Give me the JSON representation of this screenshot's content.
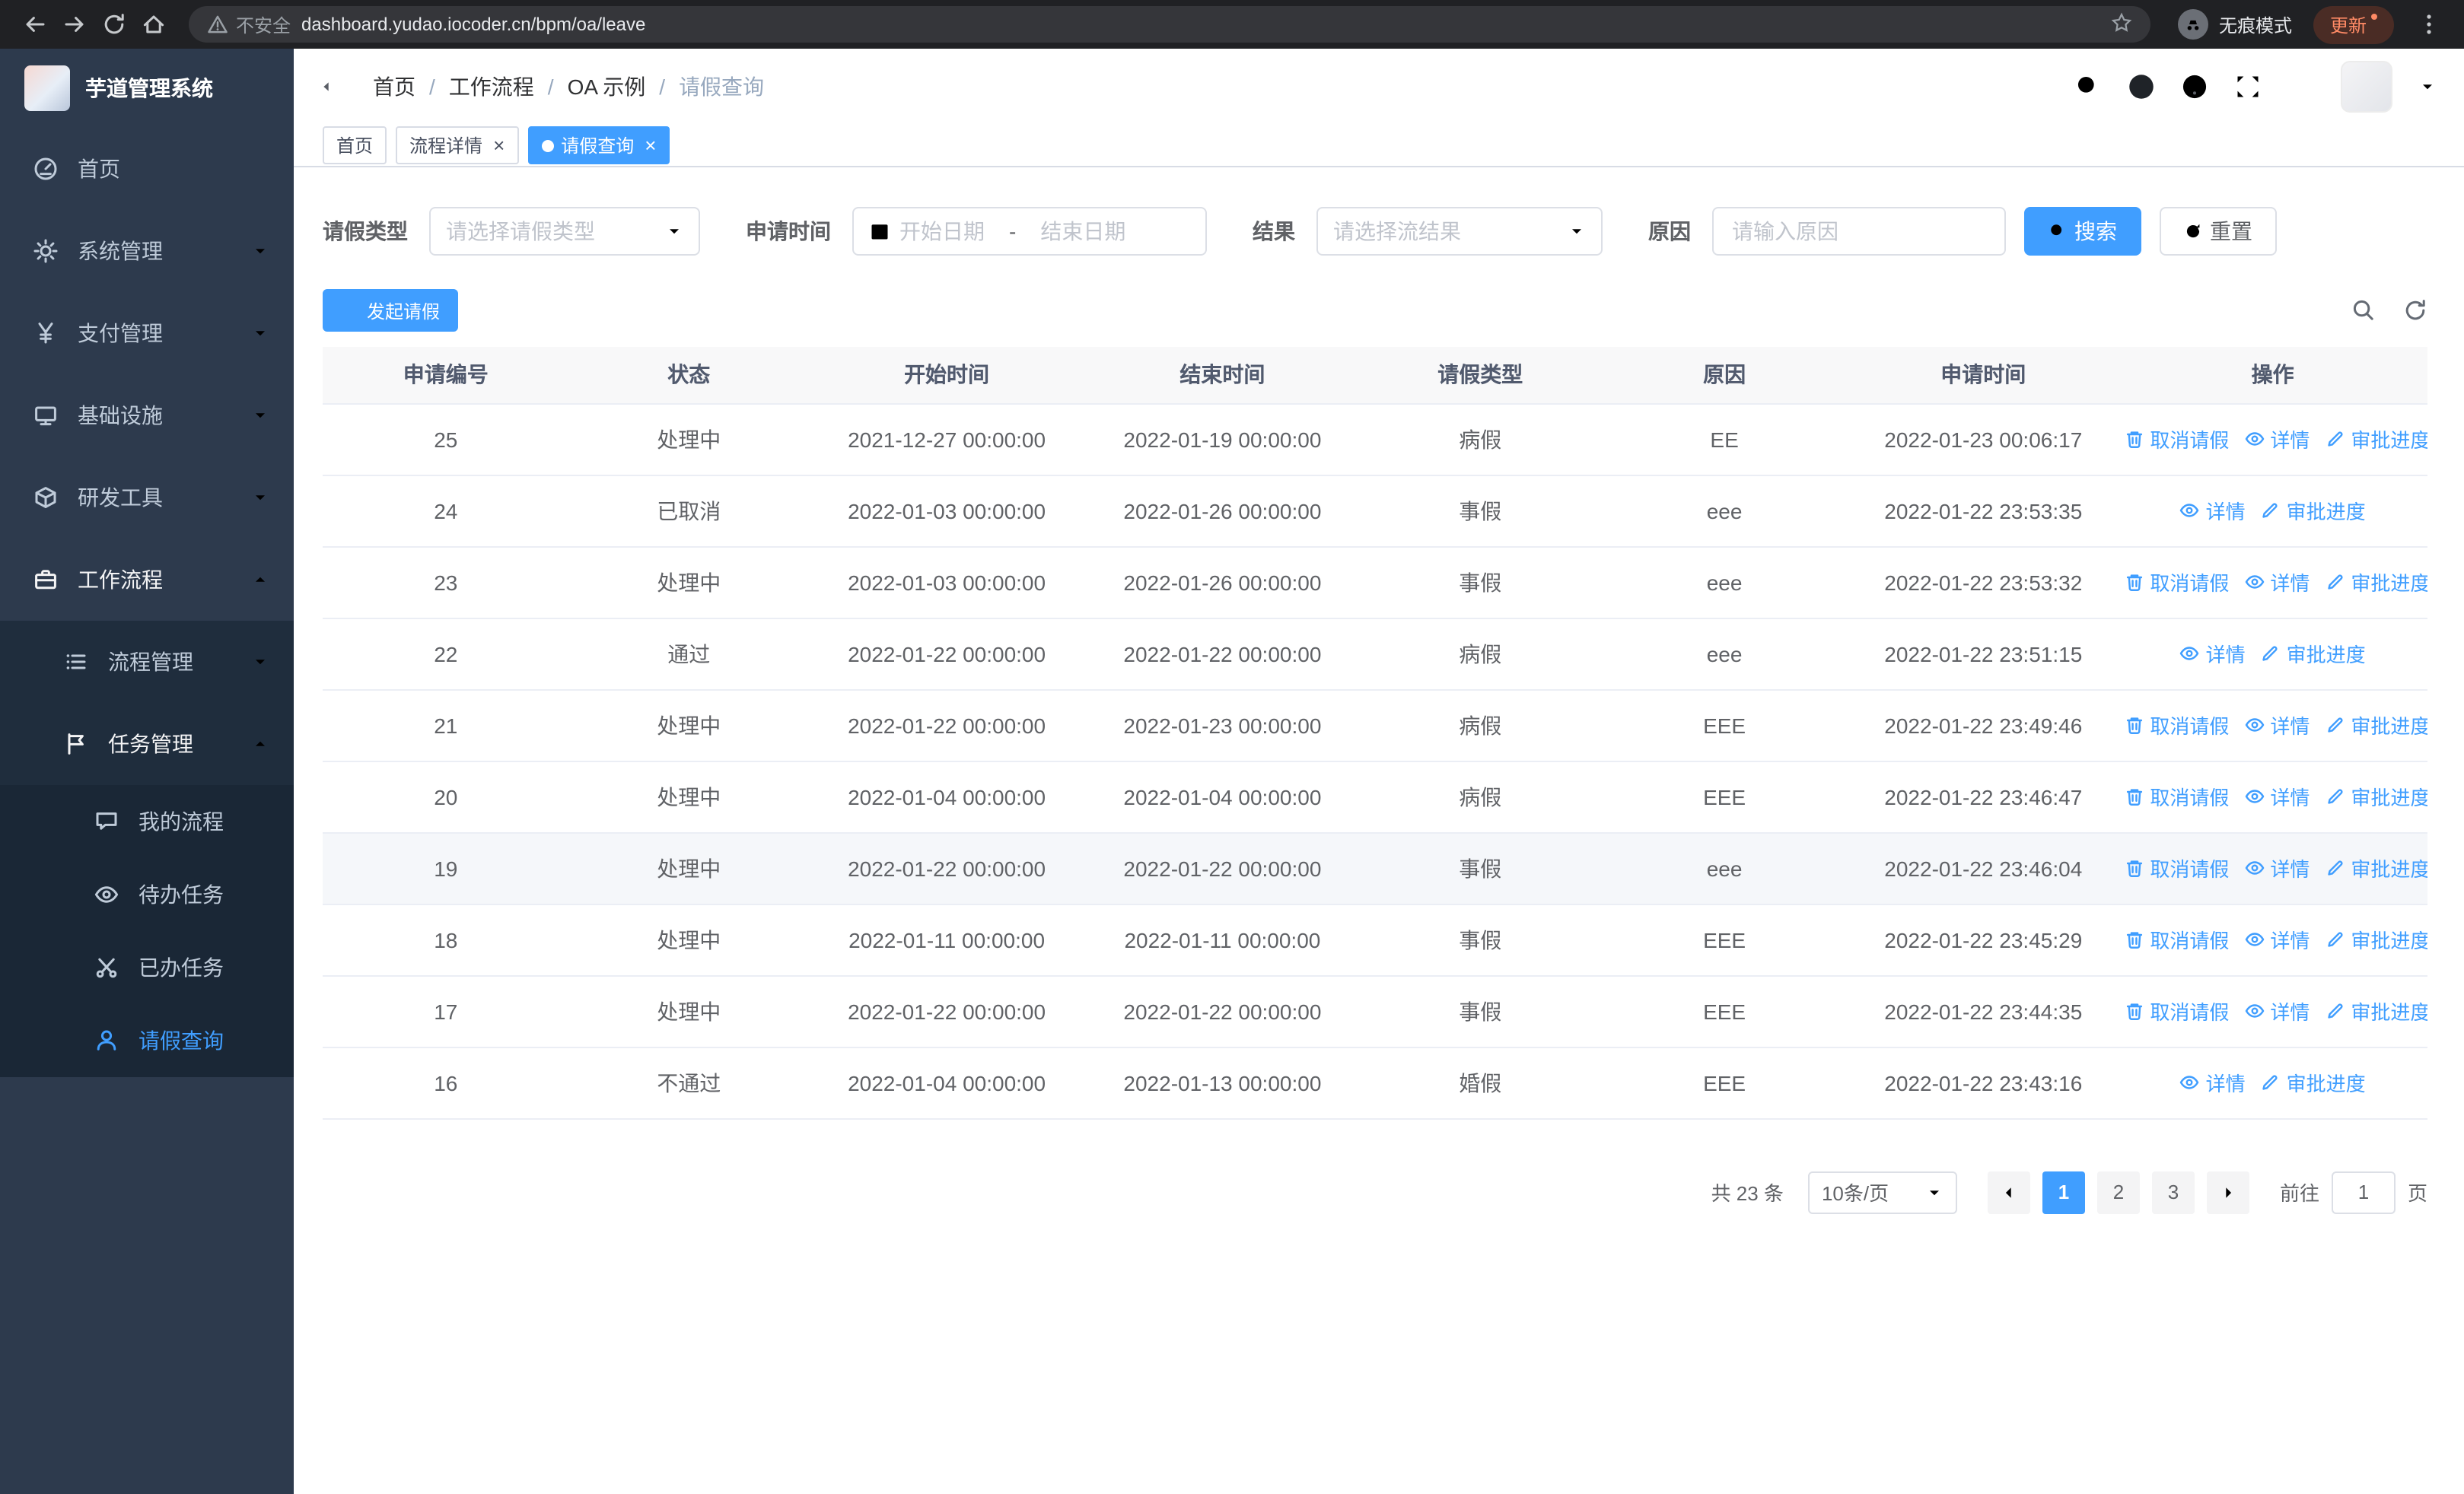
{
  "browser": {
    "security_label": "不安全",
    "url": "dashboard.yudao.iocoder.cn/bpm/oa/leave",
    "incognito_label": "无痕模式",
    "update_label": "更新"
  },
  "sidebar": {
    "logo_title": "芋道管理系统",
    "menu": [
      {
        "label": "首页"
      },
      {
        "label": "系统管理"
      },
      {
        "label": "支付管理"
      },
      {
        "label": "基础设施"
      },
      {
        "label": "研发工具"
      },
      {
        "label": "工作流程"
      }
    ],
    "submenu": [
      {
        "label": "流程管理"
      },
      {
        "label": "任务管理"
      }
    ],
    "task_menu": [
      {
        "label": "我的流程"
      },
      {
        "label": "待办任务"
      },
      {
        "label": "已办任务"
      },
      {
        "label": "请假查询",
        "active": true
      }
    ]
  },
  "header": {
    "breadcrumb": [
      "首页",
      "工作流程",
      "OA 示例",
      "请假查询"
    ],
    "breadcrumb_separator": "/"
  },
  "tabs": [
    {
      "label": "首页",
      "closable": false,
      "active": false
    },
    {
      "label": "流程详情",
      "closable": true,
      "active": false
    },
    {
      "label": "请假查询",
      "closable": true,
      "active": true
    }
  ],
  "filters": {
    "leave_type_label": "请假类型",
    "leave_type_placeholder": "请选择请假类型",
    "apply_time_label": "申请时间",
    "start_date_placeholder": "开始日期",
    "range_separator": "-",
    "end_date_placeholder": "结束日期",
    "result_label": "结果",
    "result_placeholder": "请选择流结果",
    "reason_label": "原因",
    "reason_placeholder": "请输入原因",
    "search_button": "搜索",
    "reset_button": "重置"
  },
  "toolbar": {
    "create_button": "发起请假"
  },
  "table": {
    "columns": [
      "申请编号",
      "状态",
      "开始时间",
      "结束时间",
      "请假类型",
      "原因",
      "申请时间",
      "操作"
    ],
    "action_labels": {
      "cancel": "取消请假",
      "detail": "详情",
      "progress": "审批进度"
    },
    "rows": [
      {
        "id": "25",
        "status": "处理中",
        "start": "2021-12-27 00:00:00",
        "end": "2022-01-19 00:00:00",
        "type": "病假",
        "reason": "EE",
        "applied": "2022-01-23 00:06:17",
        "actions": [
          "cancel",
          "detail",
          "progress"
        ]
      },
      {
        "id": "24",
        "status": "已取消",
        "start": "2022-01-03 00:00:00",
        "end": "2022-01-26 00:00:00",
        "type": "事假",
        "reason": "eee",
        "applied": "2022-01-22 23:53:35",
        "actions": [
          "detail",
          "progress"
        ]
      },
      {
        "id": "23",
        "status": "处理中",
        "start": "2022-01-03 00:00:00",
        "end": "2022-01-26 00:00:00",
        "type": "事假",
        "reason": "eee",
        "applied": "2022-01-22 23:53:32",
        "actions": [
          "cancel",
          "detail",
          "progress"
        ]
      },
      {
        "id": "22",
        "status": "通过",
        "start": "2022-01-22 00:00:00",
        "end": "2022-01-22 00:00:00",
        "type": "病假",
        "reason": "eee",
        "applied": "2022-01-22 23:51:15",
        "actions": [
          "detail",
          "progress"
        ]
      },
      {
        "id": "21",
        "status": "处理中",
        "start": "2022-01-22 00:00:00",
        "end": "2022-01-23 00:00:00",
        "type": "病假",
        "reason": "EEE",
        "applied": "2022-01-22 23:49:46",
        "actions": [
          "cancel",
          "detail",
          "progress"
        ]
      },
      {
        "id": "20",
        "status": "处理中",
        "start": "2022-01-04 00:00:00",
        "end": "2022-01-04 00:00:00",
        "type": "病假",
        "reason": "EEE",
        "applied": "2022-01-22 23:46:47",
        "actions": [
          "cancel",
          "detail",
          "progress"
        ]
      },
      {
        "id": "19",
        "status": "处理中",
        "start": "2022-01-22 00:00:00",
        "end": "2022-01-22 00:00:00",
        "type": "事假",
        "reason": "eee",
        "applied": "2022-01-22 23:46:04",
        "actions": [
          "cancel",
          "detail",
          "progress"
        ],
        "highlight": true
      },
      {
        "id": "18",
        "status": "处理中",
        "start": "2022-01-11 00:00:00",
        "end": "2022-01-11 00:00:00",
        "type": "事假",
        "reason": "EEE",
        "applied": "2022-01-22 23:45:29",
        "actions": [
          "cancel",
          "detail",
          "progress"
        ]
      },
      {
        "id": "17",
        "status": "处理中",
        "start": "2022-01-22 00:00:00",
        "end": "2022-01-22 00:00:00",
        "type": "事假",
        "reason": "EEE",
        "applied": "2022-01-22 23:44:35",
        "actions": [
          "cancel",
          "detail",
          "progress"
        ]
      },
      {
        "id": "16",
        "status": "不通过",
        "start": "2022-01-04 00:00:00",
        "end": "2022-01-13 00:00:00",
        "type": "婚假",
        "reason": "EEE",
        "applied": "2022-01-22 23:43:16",
        "actions": [
          "detail",
          "progress"
        ]
      }
    ]
  },
  "pagination": {
    "total_text": "共 23 条",
    "page_size": "10条/页",
    "pages": [
      "1",
      "2",
      "3"
    ],
    "active_page": "1",
    "goto_label": "前往",
    "goto_value": "1",
    "page_label": "页"
  },
  "colors": {
    "primary": "#409eff",
    "sidebar_bg": "#2d3a4d",
    "submenu_bg": "#1f2d3d",
    "chrome_bg": "#202124"
  }
}
